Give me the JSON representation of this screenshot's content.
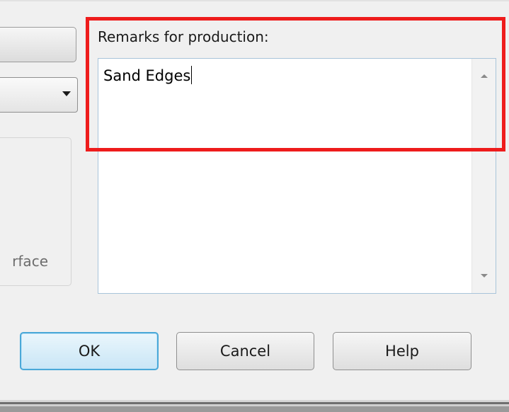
{
  "remarks": {
    "label": "Remarks for production:",
    "value": "Sand Edges"
  },
  "left_panel": {
    "group_label_fragment": "rface"
  },
  "buttons": {
    "ok": "OK",
    "cancel": "Cancel",
    "help": "Help"
  },
  "highlight": {
    "color": "#ee1c1c"
  }
}
